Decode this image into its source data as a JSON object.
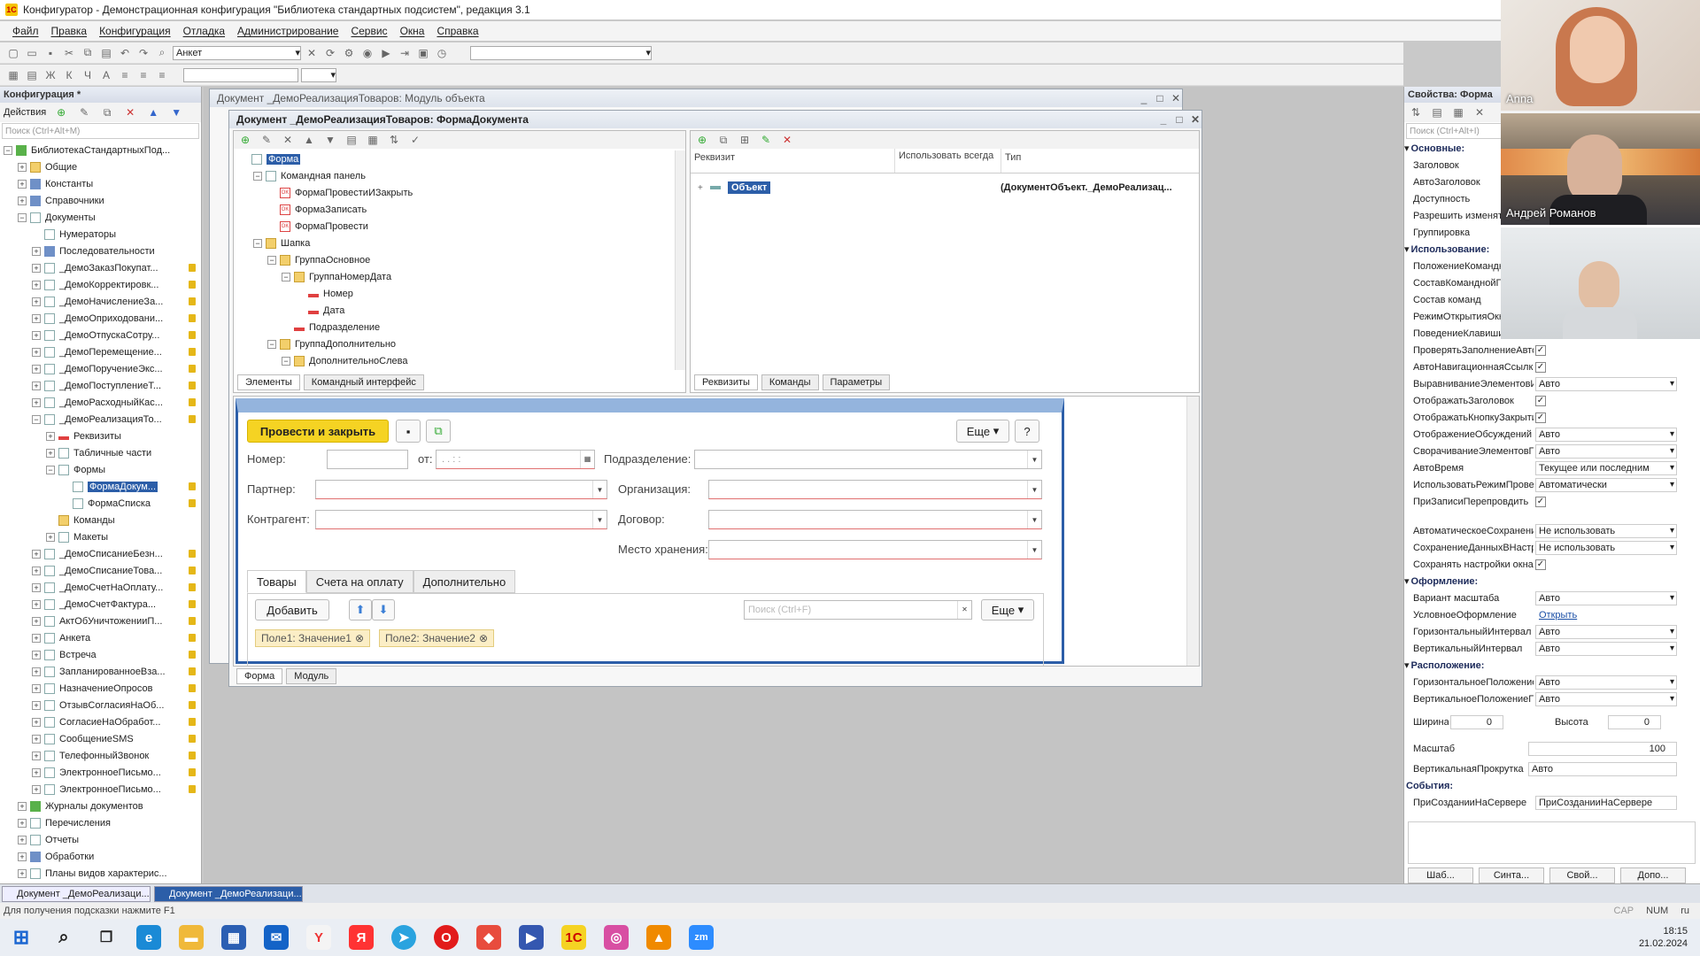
{
  "window": {
    "title": "Конфигуратор - Демонстрационная конфигурация \"Библиотека стандартных подсистем\", редакция 3.1"
  },
  "menu": [
    "Файл",
    "Правка",
    "Конфигурация",
    "Отладка",
    "Администрирование",
    "Сервис",
    "Окна",
    "Справка"
  ],
  "toolbar": {
    "search_value": "Анкет"
  },
  "config_panel": {
    "title": "Конфигурация *",
    "actions_label": "Действия",
    "search_placeholder": "Поиск (Ctrl+Alt+M)",
    "items": [
      {
        "label": "БиблиотекаСтандартныхПод...",
        "indent": 0,
        "exp": "-",
        "icon": "green"
      },
      {
        "label": "Общие",
        "indent": 1,
        "exp": "+",
        "icon": "folder"
      },
      {
        "label": "Константы",
        "indent": 1,
        "exp": "+",
        "icon": "blue"
      },
      {
        "label": "Справочники",
        "indent": 1,
        "exp": "+",
        "icon": "blue"
      },
      {
        "label": "Документы",
        "indent": 1,
        "exp": "-",
        "icon": "doc"
      },
      {
        "label": "Нумераторы",
        "indent": 2,
        "exp": "",
        "icon": "doc"
      },
      {
        "label": "Последовательности",
        "indent": 2,
        "exp": "+",
        "icon": "blue"
      },
      {
        "label": "_ДемоЗаказПокупат...",
        "indent": 2,
        "exp": "+",
        "icon": "doc",
        "lock": true
      },
      {
        "label": "_ДемоКорректировк...",
        "indent": 2,
        "exp": "+",
        "icon": "doc",
        "lock": true
      },
      {
        "label": "_ДемоНачислениеЗа...",
        "indent": 2,
        "exp": "+",
        "icon": "doc",
        "lock": true
      },
      {
        "label": "_ДемоОприходовани...",
        "indent": 2,
        "exp": "+",
        "icon": "doc",
        "lock": true
      },
      {
        "label": "_ДемоОтпускаСотру...",
        "indent": 2,
        "exp": "+",
        "icon": "doc",
        "lock": true
      },
      {
        "label": "_ДемоПеремещение...",
        "indent": 2,
        "exp": "+",
        "icon": "doc",
        "lock": true
      },
      {
        "label": "_ДемоПоручениеЭкс...",
        "indent": 2,
        "exp": "+",
        "icon": "doc",
        "lock": true
      },
      {
        "label": "_ДемоПоступлениеТ...",
        "indent": 2,
        "exp": "+",
        "icon": "doc",
        "lock": true
      },
      {
        "label": "_ДемоРасходныйКас...",
        "indent": 2,
        "exp": "+",
        "icon": "doc",
        "lock": true
      },
      {
        "label": "_ДемоРеализацияТо...",
        "indent": 2,
        "exp": "-",
        "icon": "doc",
        "lock": true
      },
      {
        "label": "Реквизиты",
        "indent": 3,
        "exp": "+",
        "icon": "red"
      },
      {
        "label": "Табличные части",
        "indent": 3,
        "exp": "+",
        "icon": "doc"
      },
      {
        "label": "Формы",
        "indent": 3,
        "exp": "-",
        "icon": "doc"
      },
      {
        "label": "ФормаДокум...",
        "indent": 4,
        "exp": "",
        "icon": "doc",
        "lock": true,
        "selected": true
      },
      {
        "label": "ФормаСписка",
        "indent": 4,
        "exp": "",
        "icon": "doc",
        "lock": true
      },
      {
        "label": "Команды",
        "indent": 3,
        "exp": "",
        "icon": "folder"
      },
      {
        "label": "Макеты",
        "indent": 3,
        "exp": "+",
        "icon": "doc"
      },
      {
        "label": "_ДемоСписаниеБезн...",
        "indent": 2,
        "exp": "+",
        "icon": "doc",
        "lock": true
      },
      {
        "label": "_ДемоСписаниеТова...",
        "indent": 2,
        "exp": "+",
        "icon": "doc",
        "lock": true
      },
      {
        "label": "_ДемоСчетНаОплату...",
        "indent": 2,
        "exp": "+",
        "icon": "doc",
        "lock": true
      },
      {
        "label": "_ДемоСчетФактура...",
        "indent": 2,
        "exp": "+",
        "icon": "doc",
        "lock": true
      },
      {
        "label": "АктОбУничтоженииП...",
        "indent": 2,
        "exp": "+",
        "icon": "doc",
        "lock": true
      },
      {
        "label": "Анкета",
        "indent": 2,
        "exp": "+",
        "icon": "doc",
        "lock": true
      },
      {
        "label": "Встреча",
        "indent": 2,
        "exp": "+",
        "icon": "doc",
        "lock": true
      },
      {
        "label": "ЗапланированноеВза...",
        "indent": 2,
        "exp": "+",
        "icon": "doc",
        "lock": true
      },
      {
        "label": "НазначениеОпросов",
        "indent": 2,
        "exp": "+",
        "icon": "doc",
        "lock": true
      },
      {
        "label": "ОтзывСогласияНаОб...",
        "indent": 2,
        "exp": "+",
        "icon": "doc",
        "lock": true
      },
      {
        "label": "СогласиеНаОбработ...",
        "indent": 2,
        "exp": "+",
        "icon": "doc",
        "lock": true
      },
      {
        "label": "СообщениеSMS",
        "indent": 2,
        "exp": "+",
        "icon": "doc",
        "lock": true
      },
      {
        "label": "ТелефонныйЗвонок",
        "indent": 2,
        "exp": "+",
        "icon": "doc",
        "lock": true
      },
      {
        "label": "ЭлектронноеПисьмо...",
        "indent": 2,
        "exp": "+",
        "icon": "doc",
        "lock": true
      },
      {
        "label": "ЭлектронноеПисьмо...",
        "indent": 2,
        "exp": "+",
        "icon": "doc",
        "lock": true
      },
      {
        "label": "Журналы документов",
        "indent": 1,
        "exp": "+",
        "icon": "green"
      },
      {
        "label": "Перечисления",
        "indent": 1,
        "exp": "+",
        "icon": "doc"
      },
      {
        "label": "Отчеты",
        "indent": 1,
        "exp": "+",
        "icon": "doc"
      },
      {
        "label": "Обработки",
        "indent": 1,
        "exp": "+",
        "icon": "blue"
      },
      {
        "label": "Планы видов характерис...",
        "indent": 1,
        "exp": "+",
        "icon": "doc"
      }
    ]
  },
  "module_window": {
    "title": "Документ _ДемоРеализацияТоваров: Модуль объекта"
  },
  "form_window": {
    "title": "Документ _ДемоРеализацияТоваров: ФормаДокумента",
    "elements_tree": [
      {
        "label": "Форма",
        "indent": 0,
        "exp": "",
        "selected": true
      },
      {
        "label": "Командная панель",
        "indent": 1,
        "exp": "-"
      },
      {
        "label": "ФормаПровестиИЗакрыть",
        "indent": 2,
        "exp": "",
        "ok": true
      },
      {
        "label": "ФормаЗаписать",
        "indent": 2,
        "exp": "",
        "ok": true
      },
      {
        "label": "ФормаПровести",
        "indent": 2,
        "exp": "",
        "ok": true
      },
      {
        "label": "Шапка",
        "indent": 1,
        "exp": "-",
        "folder": true
      },
      {
        "label": "ГруппаОсновное",
        "indent": 2,
        "exp": "-",
        "folder": true
      },
      {
        "label": "ГруппаНомерДата",
        "indent": 3,
        "exp": "-",
        "folder": true
      },
      {
        "label": "Номер",
        "indent": 4,
        "exp": "",
        "field": true
      },
      {
        "label": "Дата",
        "indent": 4,
        "exp": "",
        "field": true
      },
      {
        "label": "Подразделение",
        "indent": 3,
        "exp": "",
        "field": true
      },
      {
        "label": "ГруппаДополнительно",
        "indent": 2,
        "exp": "-",
        "folder": true
      },
      {
        "label": "ДополнительноСлева",
        "indent": 3,
        "exp": "-",
        "folder": true
      }
    ],
    "left_tabs": [
      "Элементы",
      "Командный интерфейс"
    ],
    "attr_headers": {
      "rekvizit": "Реквизит",
      "use_always": "Использовать всегда",
      "type": "Тип"
    },
    "attr_row": {
      "name": "Объект",
      "type": "(ДокументОбъект._ДемоРеализац..."
    },
    "right_tabs": [
      "Реквизиты",
      "Команды",
      "Параметры"
    ],
    "bottom_tabs": [
      "Форма",
      "Модуль"
    ]
  },
  "preview": {
    "post_close": "Провести и закрыть",
    "more": "Еще",
    "help": "?",
    "nomer_label": "Номер:",
    "ot_label": "от:",
    "date_placeholder": " .  .       :  :",
    "podr_label": "Подразделение:",
    "partner_label": "Партнер:",
    "org_label": "Организация:",
    "kontr_label": "Контрагент:",
    "dogovor_label": "Договор:",
    "mesto_label": "Место хранения:",
    "tabs": [
      "Товары",
      "Счета на оплату",
      "Дополнительно"
    ],
    "add": "Добавить",
    "search_placeholder": "Поиск (Ctrl+F)",
    "more2": "Еще",
    "filters": [
      "Поле1: Значение1",
      "Поле2: Значение2"
    ]
  },
  "props": {
    "title": "Свойства: Форма",
    "search_placeholder": "Поиск (Ctrl+Alt+I)",
    "rows": [
      {
        "t": "sec",
        "name": "Основные:"
      },
      {
        "t": "txt",
        "name": "Заголовок"
      },
      {
        "t": "txt",
        "name": "АвтоЗаголовок"
      },
      {
        "t": "txt",
        "name": "Доступность"
      },
      {
        "t": "txt",
        "name": "Разрешить изменять"
      },
      {
        "t": "txt",
        "name": "Группировка"
      },
      {
        "t": "sec",
        "name": "Использование:"
      },
      {
        "t": "txt",
        "name": "ПоложениеКоманднойП"
      },
      {
        "t": "txt",
        "name": "СоставКоманднойП"
      },
      {
        "t": "txt",
        "name": "Состав команд"
      },
      {
        "t": "txt",
        "name": "РежимОткрытияОкна"
      },
      {
        "t": "txt",
        "name": "ПоведениеКлавиши"
      },
      {
        "t": "chk",
        "name": "ПроверятьЗаполнениеАвто"
      },
      {
        "t": "chk",
        "name": "АвтоНавигационнаяСсылка"
      },
      {
        "t": "val",
        "name": "ВыравниваниеЭлементовИ",
        "value": "Авто"
      },
      {
        "t": "chk",
        "name": "ОтображатьЗаголовок"
      },
      {
        "t": "chk",
        "name": "ОтображатьКнопкуЗакрыти"
      },
      {
        "t": "val",
        "name": "ОтображениеОбсуждений",
        "value": "Авто"
      },
      {
        "t": "val",
        "name": "СворачиваниеЭлементовПо",
        "value": "Авто"
      },
      {
        "t": "val",
        "name": "АвтоВремя",
        "value": "Текущее или последним"
      },
      {
        "t": "val",
        "name": "ИспользоватьРежимПрове",
        "value": "Автоматически"
      },
      {
        "t": "chk",
        "name": "ПриЗаписиПерепровдить"
      },
      {
        "t": "gap"
      },
      {
        "t": "val",
        "name": "АвтоматическоеСохранени",
        "value": "Не использовать"
      },
      {
        "t": "val",
        "name": "СохранениеДанныхВНастр",
        "value": "Не использовать"
      },
      {
        "t": "chk",
        "name": "Сохранять настройки окна"
      },
      {
        "t": "sec",
        "name": "Оформление:"
      },
      {
        "t": "val",
        "name": "Вариант масштаба",
        "value": "Авто"
      },
      {
        "t": "link",
        "name": "УсловноеОформление",
        "value": "Открыть"
      },
      {
        "t": "val",
        "name": "ГоризонтальныйИнтервал",
        "value": "Авто"
      },
      {
        "t": "val",
        "name": "ВертикальныйИнтервал",
        "value": "Авто"
      },
      {
        "t": "sec",
        "name": "Расположение:"
      },
      {
        "t": "val",
        "name": "ГоризонтальноеПоложение",
        "value": "Авто"
      },
      {
        "t": "val",
        "name": "ВертикальноеПоложениеП",
        "value": "Авто"
      }
    ],
    "width_label": "Ширина",
    "width_value": "0",
    "height_label": "Высота",
    "height_value": "0",
    "scale_label": "Масштаб",
    "scale_value": "100",
    "vscroll_label": "ВертикальнаяПрокрутка",
    "vscroll_value": "Авто",
    "events_label": "События:",
    "on_create_label": "ПриСозданииНаСервере",
    "on_create_value": "ПриСозданииНаСервере",
    "bottom_buttons": [
      "Шаб...",
      "Синта...",
      "Свой...",
      "Допо..."
    ]
  },
  "open_windows": [
    "Документ _ДемоРеализаци...",
    "Документ _ДемоРеализаци..."
  ],
  "status": {
    "hint": "Для получения подсказки нажмите F1",
    "cap": "CAP",
    "num": "NUM",
    "lang": "ru"
  },
  "participants": [
    "Anna",
    "Андрей Романов",
    ""
  ],
  "clock": {
    "time": "18:15",
    "date": "21.02.2024"
  }
}
